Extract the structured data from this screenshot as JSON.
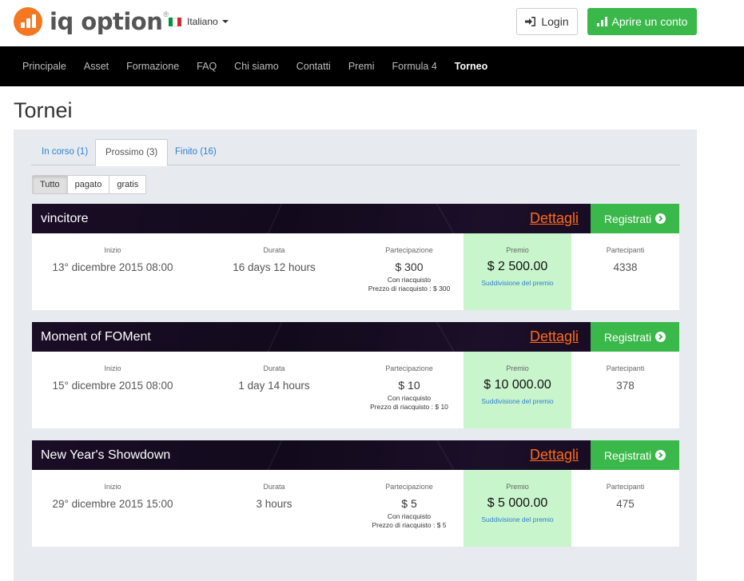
{
  "header": {
    "logo_text": "iq option",
    "logo_mark": "®",
    "language": "Italiano",
    "login_label": "Login",
    "open_account_label": "Aprire un conto"
  },
  "nav": {
    "items": [
      "Principale",
      "Asset",
      "Formazione",
      "FAQ",
      "Chi siamo",
      "Contatti",
      "Premi",
      "Formula 4",
      "Torneo"
    ],
    "active_index": 8
  },
  "page": {
    "title": "Tornei"
  },
  "tabs": {
    "items": [
      "In corso (1)",
      "Prossimo (3)",
      "Finito (16)"
    ],
    "active_index": 1
  },
  "filters": {
    "items": [
      "Tutto",
      "pagato",
      "gratis"
    ],
    "active_index": 0
  },
  "card_labels": {
    "start": "Inizio",
    "duration": "Durata",
    "participation": "Partecipazione",
    "prize": "Premio",
    "participants": "Partecipanti",
    "details": "Dettagli",
    "register": "Registrati",
    "prize_split": "Suddivisione del premio",
    "rebuy": "Con riacquisto"
  },
  "tournaments": [
    {
      "name": "vincitore",
      "start": "13° dicembre 2015 08:00",
      "duration": "16 days 12 hours",
      "fee": "$ 300",
      "rebuy_price": "Prezzo di riacquisto : $ 300",
      "prize": "$ 2 500.00",
      "participants": "4338"
    },
    {
      "name": "Moment of FOMent",
      "start": "15° dicembre 2015 08:00",
      "duration": "1 day 14 hours",
      "fee": "$ 10",
      "rebuy_price": "Prezzo di riacquisto : $ 10",
      "prize": "$ 10 000.00",
      "participants": "378"
    },
    {
      "name": "New Year's Showdown",
      "start": "29° dicembre 2015 15:00",
      "duration": "3 hours",
      "fee": "$ 5",
      "rebuy_price": "Prezzo di riacquisto : $ 5",
      "prize": "$ 5 000.00",
      "participants": "475"
    }
  ],
  "colors": {
    "brand_orange": "#f47721",
    "green": "#3ab84a",
    "prize_bg": "#c9f5cd",
    "link_blue": "#2e7fd1",
    "details_orange": "#ff6a1a"
  }
}
